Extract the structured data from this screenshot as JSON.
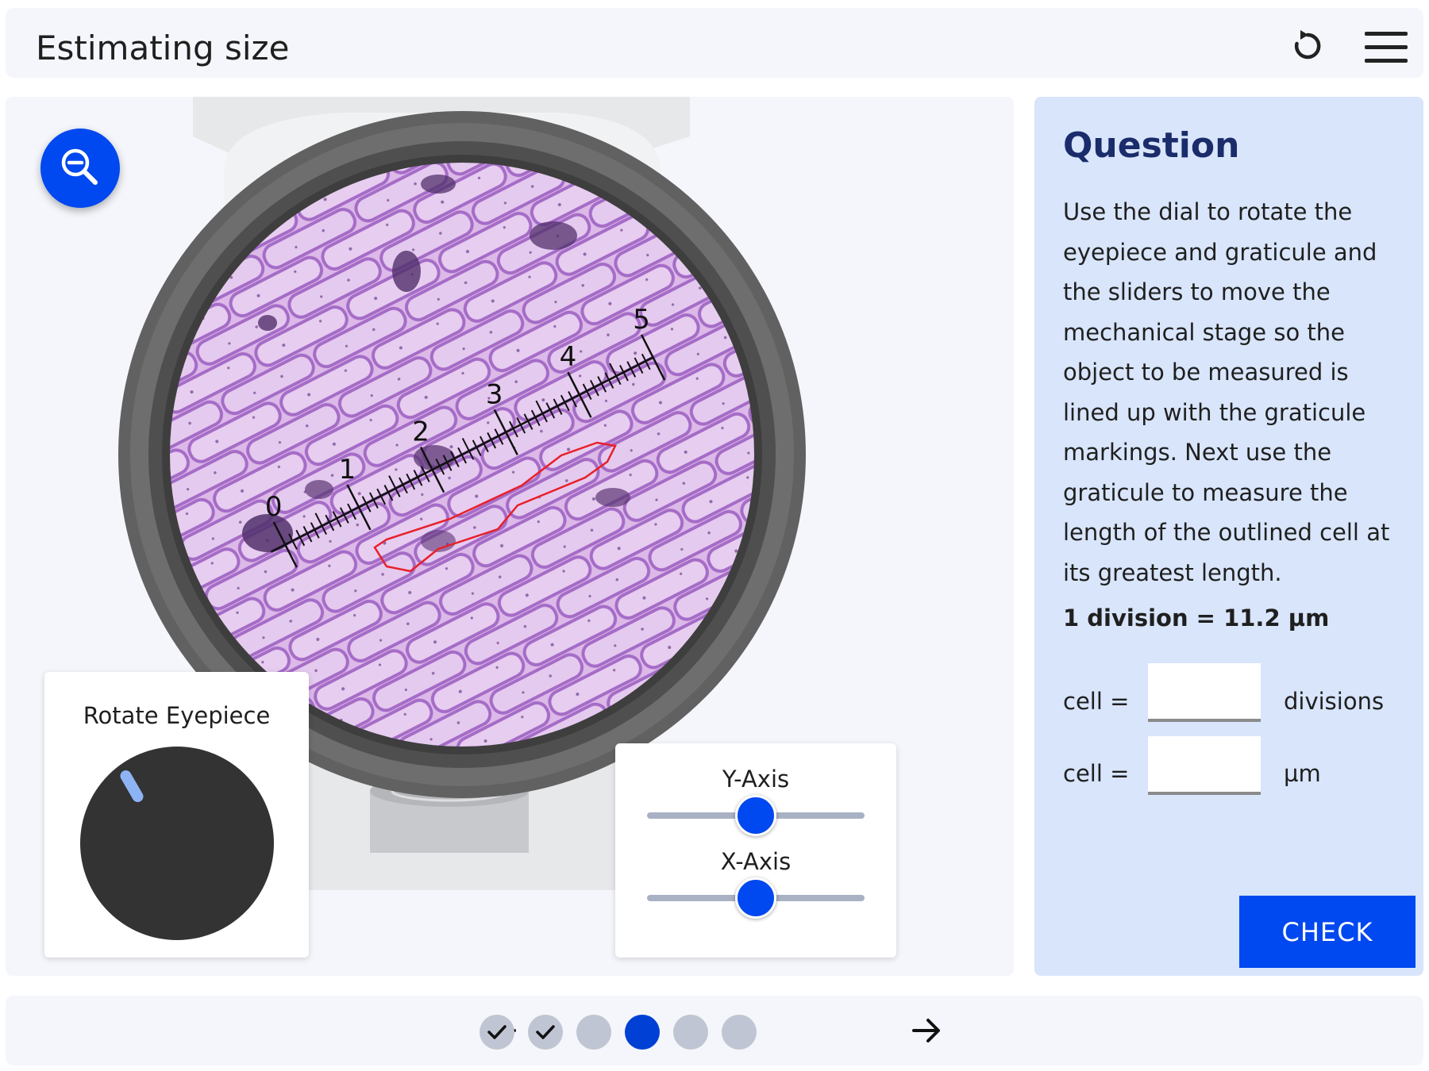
{
  "header": {
    "title": "Estimating size",
    "reset_icon": "reset-icon",
    "menu_icon": "hamburger-menu-icon"
  },
  "stage": {
    "zoom_icon": "zoom-out-icon",
    "graticule_numbers": [
      "0",
      "1",
      "2",
      "3",
      "4",
      "5"
    ],
    "rotate_label": "Rotate Eyepiece",
    "y_axis_label": "Y-Axis",
    "x_axis_label": "X-Axis",
    "y_axis_value": 0.5,
    "x_axis_value": 0.5
  },
  "question": {
    "heading": "Question",
    "body": "Use the dial to rotate the eyepiece and graticule and the sliders to move the mechanical stage so the object to be measured is lined up with the graticule markings. Next use the graticule to measure the length of the outlined cell at its greatest length.",
    "division": "1 division = 11.2 µm",
    "row1_label": "cell =",
    "row1_unit": "divisions",
    "row1_value": "",
    "row2_label": "cell =",
    "row2_unit": "µm",
    "row2_value": "",
    "check_label": "CHECK"
  },
  "footer": {
    "prev_icon": "arrow-left-icon",
    "next_icon": "arrow-right-icon",
    "steps": [
      {
        "state": "done"
      },
      {
        "state": "done"
      },
      {
        "state": "todo"
      },
      {
        "state": "current"
      },
      {
        "state": "todo"
      },
      {
        "state": "todo"
      }
    ]
  },
  "colors": {
    "accent": "#0048f0",
    "question_bg": "#d8e5fb",
    "heading": "#1b2c6b",
    "cell_outline": "#e8202a",
    "specimen": "#d9b6e6",
    "cell_wall": "#a46bc6"
  }
}
